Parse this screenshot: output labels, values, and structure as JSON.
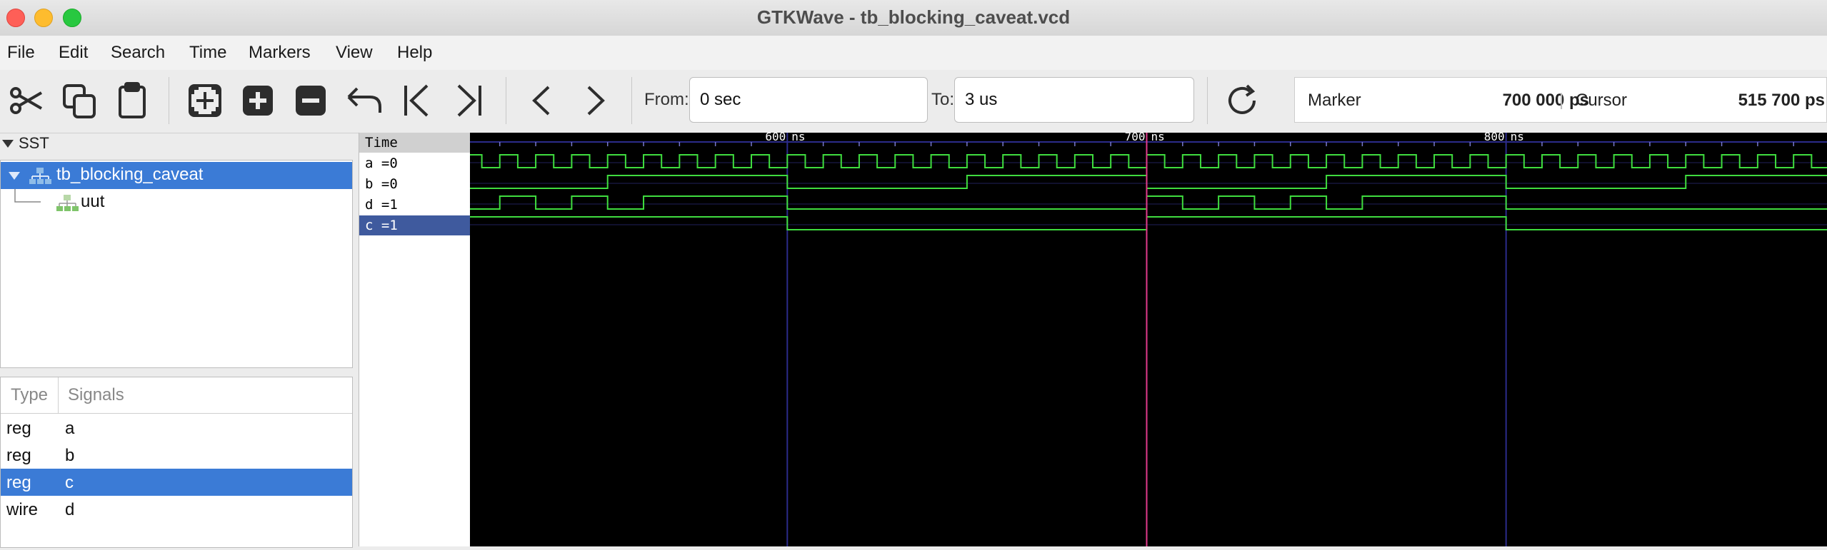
{
  "window": {
    "title": "GTKWave - tb_blocking_caveat.vcd"
  },
  "menu": [
    "File",
    "Edit",
    "Search",
    "Time",
    "Markers",
    "View",
    "Help"
  ],
  "toolbar": {
    "from_label": "From:",
    "from_value": "0 sec",
    "to_label": "To:",
    "to_value": "3 us",
    "marker_label": "Marker",
    "marker_value": "700 000 ps",
    "cursor_label": "Cursor",
    "cursor_value": "515 700 ps"
  },
  "sst": {
    "header": "SST",
    "tree": [
      {
        "label": "tb_blocking_caveat",
        "selected": true
      },
      {
        "label": "uut",
        "selected": false
      }
    ]
  },
  "signals_panel": {
    "col_type": "Type",
    "col_signals": "Signals",
    "rows": [
      {
        "type": "reg",
        "name": "a",
        "selected": false
      },
      {
        "type": "reg",
        "name": "b",
        "selected": false
      },
      {
        "type": "reg",
        "name": "c",
        "selected": true
      },
      {
        "type": "wire",
        "name": "d",
        "selected": false
      }
    ]
  },
  "wave_names": {
    "header": "Time",
    "rows": [
      {
        "label": "a =0",
        "selected": false
      },
      {
        "label": "b =0",
        "selected": false
      },
      {
        "label": "d =1",
        "selected": false
      },
      {
        "label": "c =1",
        "selected": true
      }
    ]
  },
  "timeline": {
    "ticks": [
      {
        "t": 600,
        "label": "600 ns"
      },
      {
        "t": 700,
        "label": "700 ns"
      },
      {
        "t": 800,
        "label": "800 ns"
      }
    ],
    "view_start_ns": 511.7,
    "view_end_ns": 889.3,
    "marker_ns": 700,
    "colors": {
      "wave": "#3fdc3f",
      "grid": "#2b2b8a",
      "marker": "#e23a8a",
      "bg": "#000000"
    }
  },
  "waveforms": {
    "a_period_ns": 10,
    "b_transitions_ns": [
      550,
      600,
      650,
      700,
      750,
      800,
      850
    ],
    "b_initial": 0,
    "d_initial": 0,
    "d_transitions_ns": [
      520,
      530,
      540,
      550,
      560,
      600,
      700,
      710,
      720,
      730,
      740,
      750,
      760,
      800
    ],
    "c_initial": 1,
    "c_transitions_ns": [
      600,
      700,
      800
    ]
  }
}
